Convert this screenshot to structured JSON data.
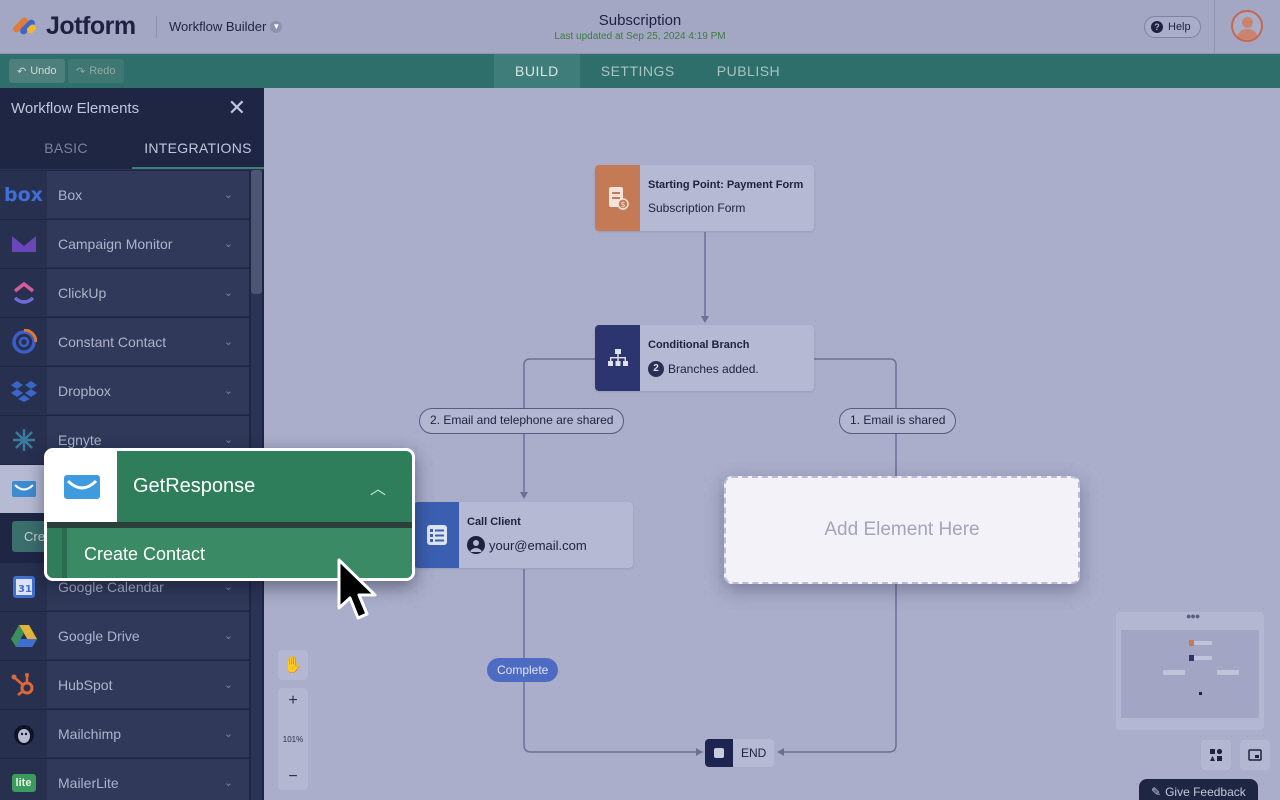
{
  "header": {
    "logo_text": "Jotform",
    "workflow_builder_label": "Workflow Builder",
    "form_title": "Subscription",
    "last_updated": "Last updated at Sep 25, 2024 4:19 PM",
    "help_label": "Help"
  },
  "toolbar": {
    "undo_label": "Undo",
    "redo_label": "Redo",
    "tabs": [
      {
        "label": "BUILD"
      },
      {
        "label": "SETTINGS"
      },
      {
        "label": "PUBLISH"
      }
    ]
  },
  "sidebar": {
    "title": "Workflow Elements",
    "tabs": [
      {
        "label": "BASIC"
      },
      {
        "label": "INTEGRATIONS"
      }
    ],
    "integrations": [
      {
        "label": "Box",
        "icon": "box-icon"
      },
      {
        "label": "Campaign Monitor",
        "icon": "campaign-monitor-icon"
      },
      {
        "label": "ClickUp",
        "icon": "clickup-icon"
      },
      {
        "label": "Constant Contact",
        "icon": "constant-contact-icon"
      },
      {
        "label": "Dropbox",
        "icon": "dropbox-icon"
      },
      {
        "label": "Egnyte",
        "icon": "egnyte-icon"
      },
      {
        "label": "Google Calendar",
        "icon": "google-calendar-icon"
      },
      {
        "label": "Google Drive",
        "icon": "google-drive-icon"
      },
      {
        "label": "HubSpot",
        "icon": "hubspot-icon"
      },
      {
        "label": "Mailchimp",
        "icon": "mailchimp-icon"
      },
      {
        "label": "MailerLite",
        "icon": "mailerlite-icon"
      }
    ],
    "create_peek": "Cre"
  },
  "popup": {
    "name": "GetResponse",
    "action": "Create Contact"
  },
  "canvas": {
    "start_node": {
      "title": "Starting Point: Payment Form",
      "subtitle": "Subscription Form"
    },
    "branch_node": {
      "title": "Conditional Branch",
      "count": "2",
      "subtitle": "Branches added."
    },
    "condition_left": "2. Email and telephone are shared",
    "condition_right": "1. Email is shared",
    "call_node": {
      "title": "Call Client",
      "subtitle": "your@email.com"
    },
    "add_element": "Add Element Here",
    "complete_label": "Complete",
    "end_label": "END",
    "zoom_level": "101%",
    "zoom_in": "+",
    "zoom_out": "−"
  },
  "feedback_label": "Give Feedback",
  "colors": {
    "toolbar": "#2f6f6b",
    "sidebar": "#1f2644",
    "popup": "#2f7e5b",
    "start_icon_bg": "#c47a55",
    "branch_icon_bg": "#2d3570",
    "call_icon_bg": "#3b5fb0",
    "complete_pill": "#4e6bc4"
  }
}
